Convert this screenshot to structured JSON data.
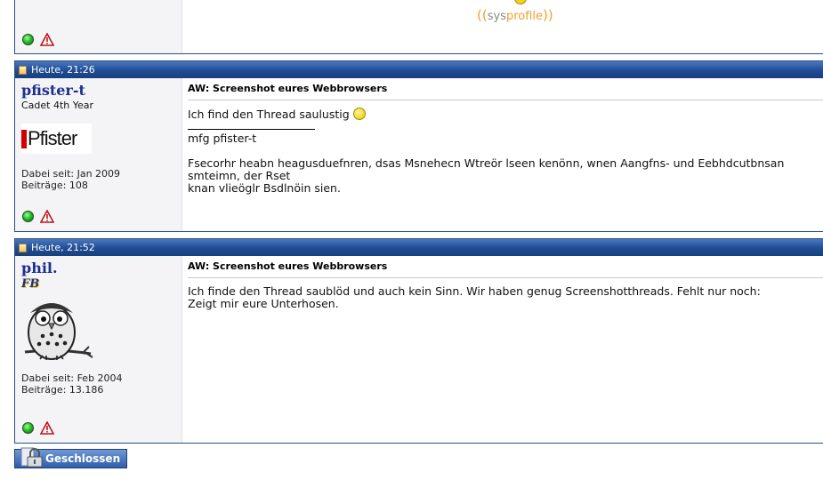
{
  "top_post": {
    "sysprofile_open": "((",
    "sysprofile_sys": "sys",
    "sysprofile_profile": "profile",
    "sysprofile_close": "))"
  },
  "posts": [
    {
      "header": "Heute, 21:26",
      "username": "pfister-t",
      "usertitle": "Cadet 4th Year",
      "avatar_text": "Pfister",
      "joined": "Dabei seit: Jan 2009",
      "posts_count": "Beiträge: 108",
      "title": "AW: Screenshot eures Webbrowsers",
      "message": "Ich find den Thread saulustig",
      "signature_1": "mfg pfister-t",
      "signature_2": "Fsecorhr heabn heagusduefnren, dsas Msnehecn Wtreör lseen kenönn, wnen Aangfns- und Eebhdcutbnsan smteimn, der Rset",
      "signature_3": "knan vlieöglr Bsdlnöin sien."
    },
    {
      "header": "Heute, 21:52",
      "username": "phil.",
      "badge": "FB",
      "joined": "Dabei seit: Feb 2004",
      "posts_count": "Beiträge: 13.186",
      "title": "AW: Screenshot eures Webbrowsers",
      "message_1": "Ich finde den Thread saublöd und auch kein Sinn. Wir haben genug Screenshotthreads. Fehlt nur noch:",
      "message_2": "Zeigt mir eure Unterhosen."
    }
  ],
  "footer": {
    "closed_label": "Geschlossen"
  },
  "colors": {
    "header_blue": "#1f4c92",
    "username": "#1d2f8c",
    "sysprofile": "#f0a030"
  }
}
